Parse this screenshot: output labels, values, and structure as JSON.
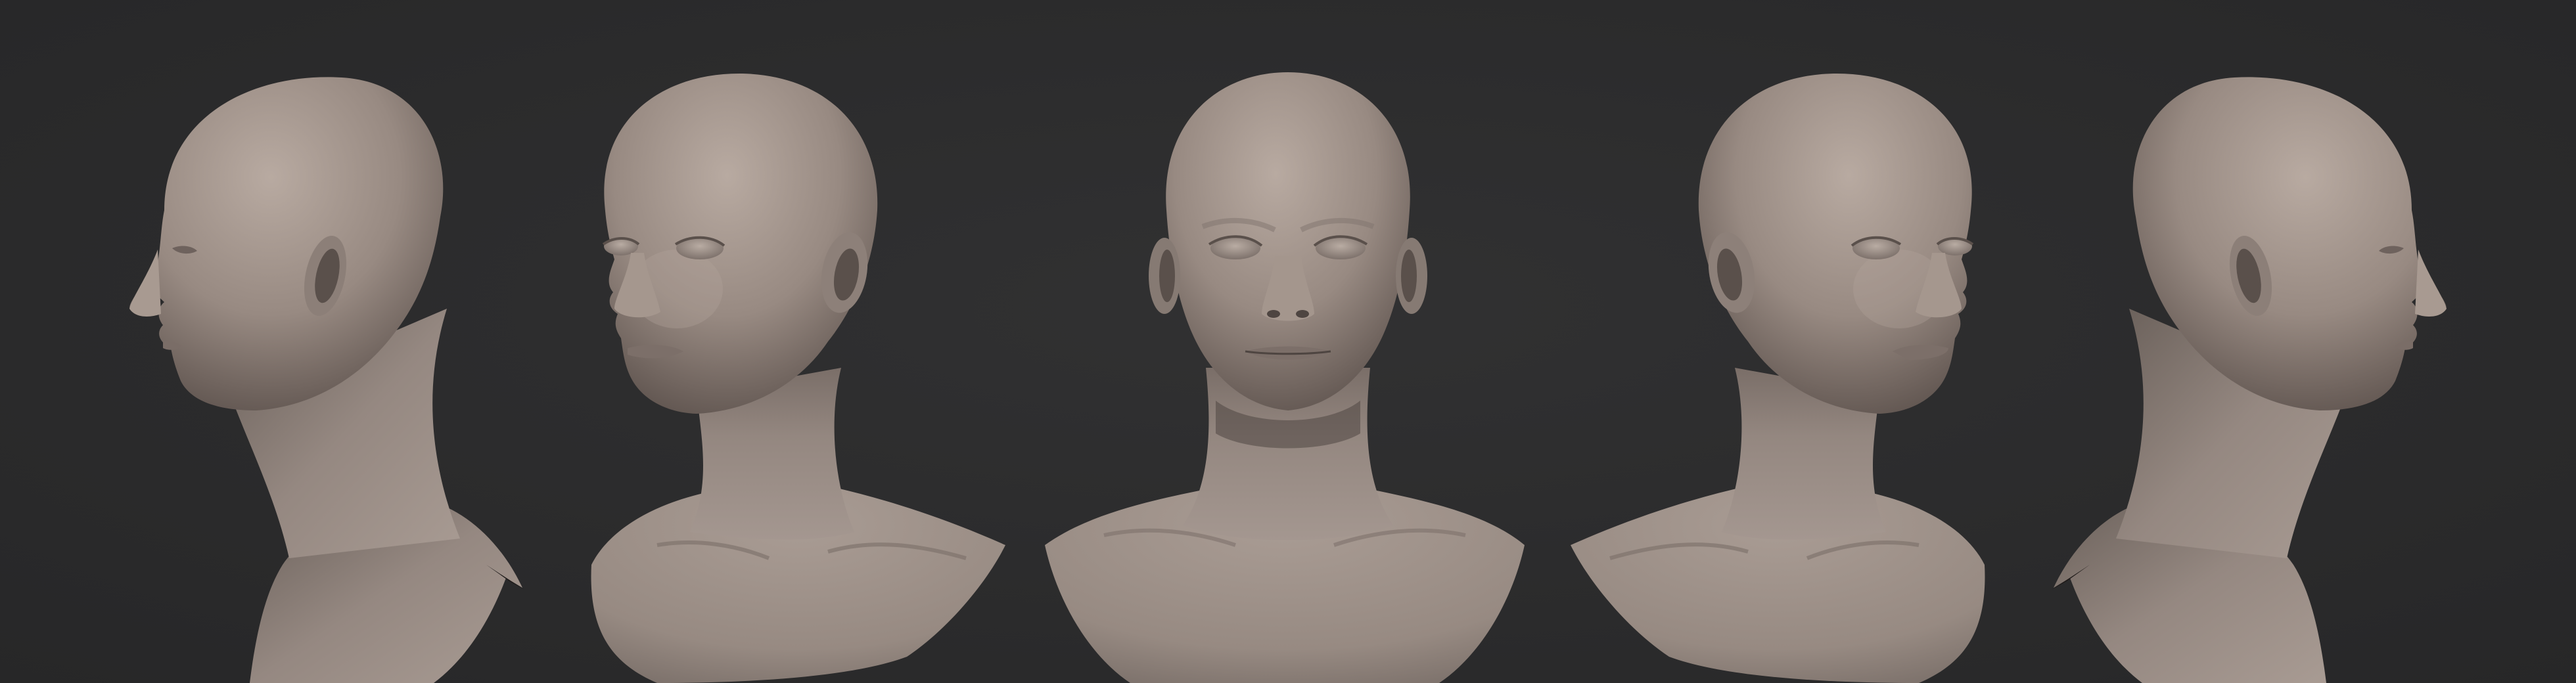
{
  "scene": {
    "background_color": "#2c2c2d",
    "skin_color": "#9a8c84",
    "skin_highlight": "#b5a79e",
    "skin_shadow": "#4a413d",
    "views": [
      {
        "name": "left-profile"
      },
      {
        "name": "left-three-quarter"
      },
      {
        "name": "front"
      },
      {
        "name": "right-three-quarter"
      },
      {
        "name": "right-profile"
      }
    ]
  }
}
